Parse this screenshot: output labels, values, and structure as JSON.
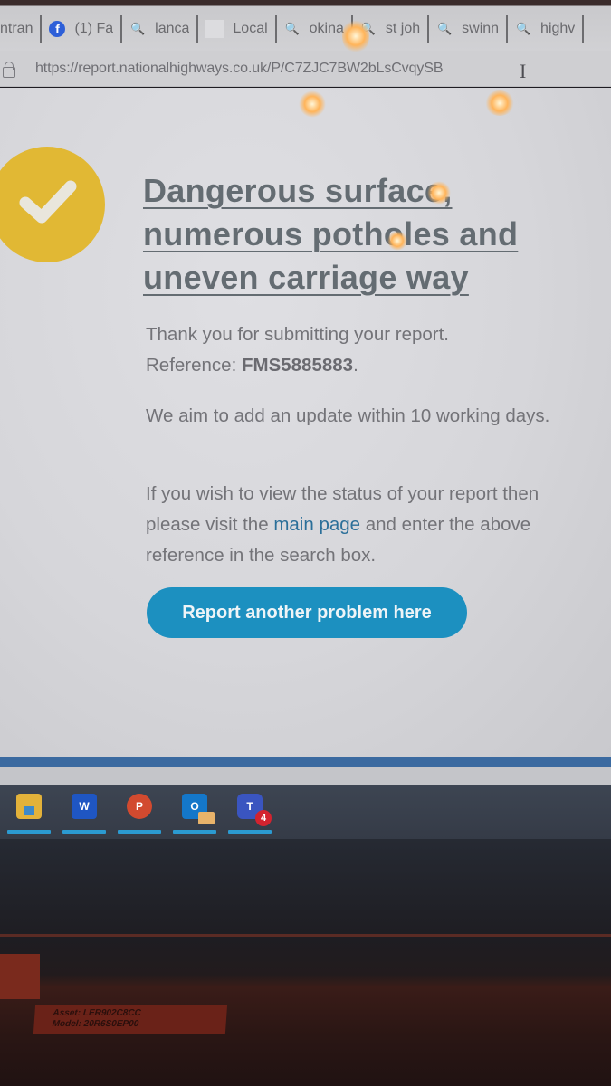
{
  "browser": {
    "tabs": [
      {
        "label": "ntran",
        "icon": "none"
      },
      {
        "label": "(1) Fa",
        "icon": "facebook-icon"
      },
      {
        "label": "lanca",
        "icon": "search-icon"
      },
      {
        "label": "Local",
        "icon": "blank-page-icon"
      },
      {
        "label": "okina",
        "icon": "search-icon"
      },
      {
        "label": "st joh",
        "icon": "search-icon"
      },
      {
        "label": "swinn",
        "icon": "search-icon"
      },
      {
        "label": "highv",
        "icon": "search-icon"
      }
    ],
    "url": "https://report.nationalhighways.co.uk/P/C7ZJC7BW2bLsCvqySB"
  },
  "page": {
    "status_icon": "check-circle-icon",
    "title": "Dangerous surface, numerous potholes and uneven carriage way",
    "thanks": "Thank you for submitting your report.",
    "reference_label": "Reference:",
    "reference_value": "FMS5885883",
    "reference_suffix": ".",
    "update_text": "We aim to add an update within 10 working days.",
    "status_text_before": "If you wish to view the status of your report then please visit the",
    "main_page_link": "main page",
    "status_text_after": "and enter the above reference in the search box.",
    "cta_label": "Report another problem here"
  },
  "taskbar": {
    "apps": [
      {
        "name": "File Explorer",
        "icon": "folder-icon"
      },
      {
        "name": "Word",
        "icon": "word-icon",
        "glyph": "W"
      },
      {
        "name": "PowerPoint",
        "icon": "powerpoint-icon",
        "glyph": "P"
      },
      {
        "name": "Outlook",
        "icon": "outlook-icon",
        "glyph": "O"
      },
      {
        "name": "Teams",
        "icon": "teams-icon",
        "glyph": "T",
        "badge": "4"
      }
    ]
  },
  "hardware_label": {
    "asset": "Asset: LER902C8CC",
    "model": "Model: 20R6S0EP00"
  },
  "colors": {
    "accent_button": "#1c90c0",
    "check_circle": "#e1b834",
    "link": "#2b6f99",
    "title_text": "#646c72"
  }
}
